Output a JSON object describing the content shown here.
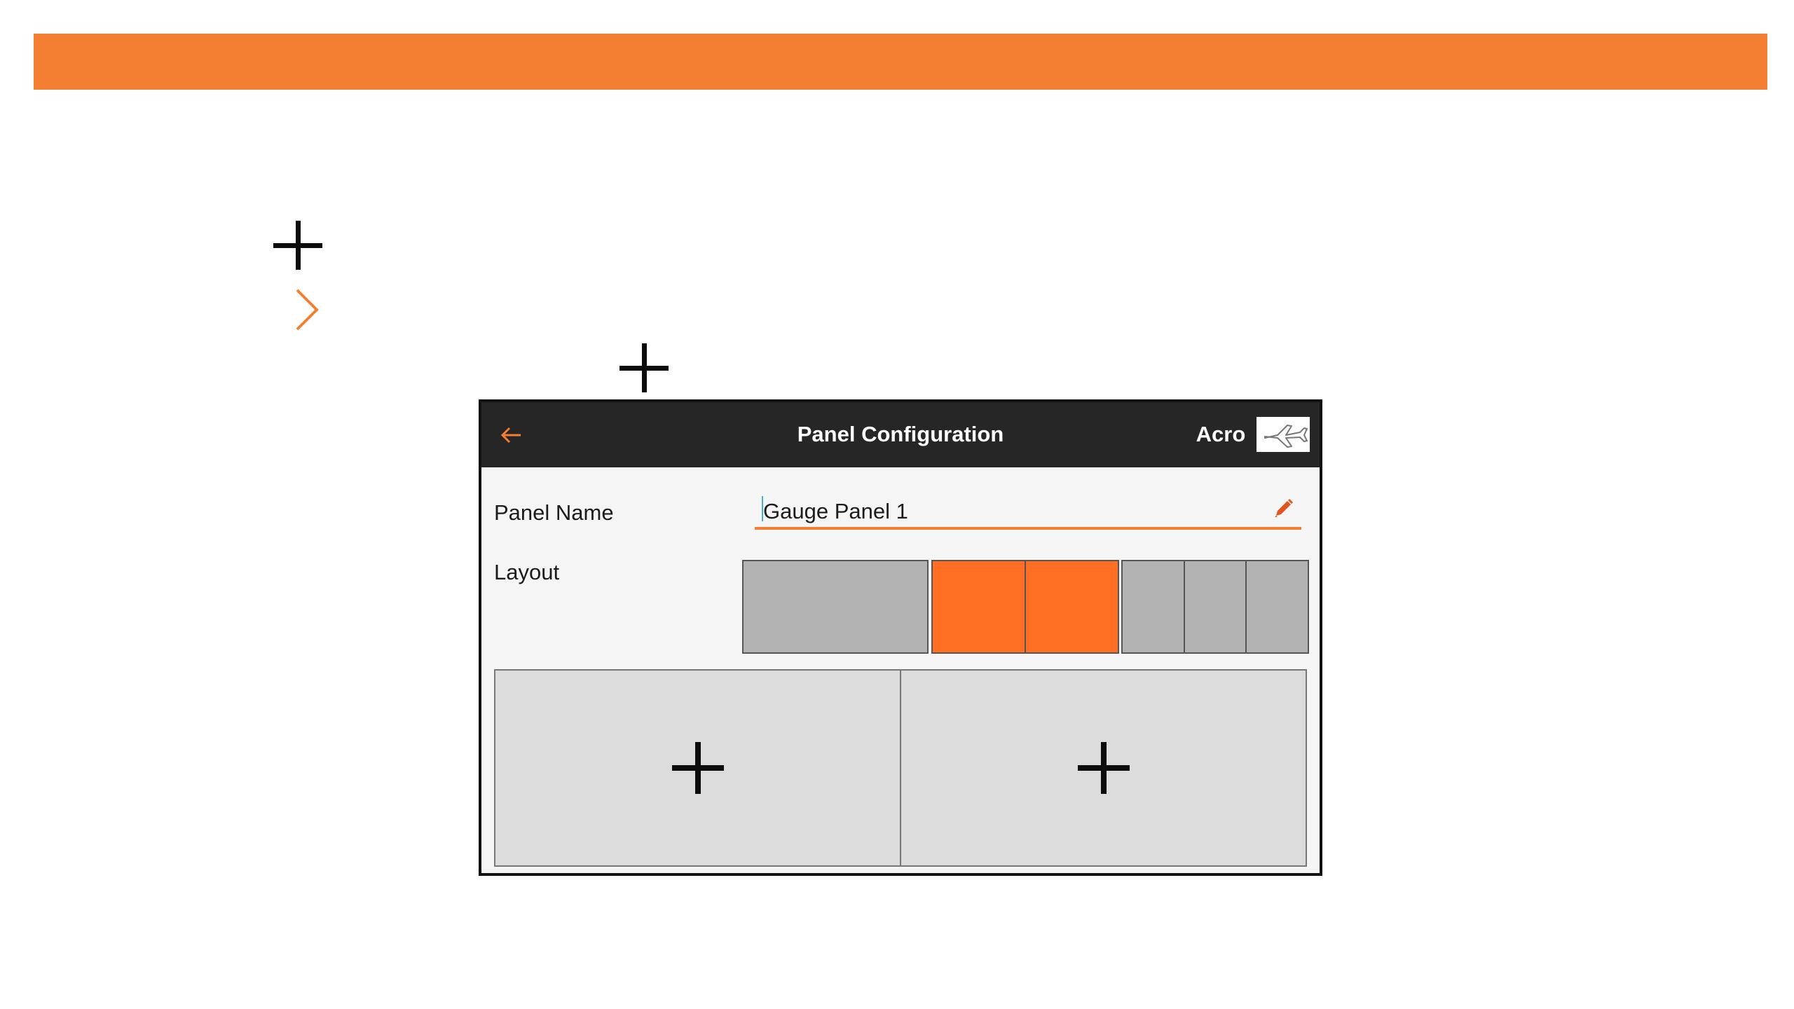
{
  "colors": {
    "accent": "#f47f32",
    "selected": "#ff6e23",
    "titlebar": "#262626"
  },
  "header": {
    "title": "Panel Configuration",
    "model": "Acro",
    "back_icon": "back-arrow-icon",
    "model_icon": "airplane-icon"
  },
  "panel_name": {
    "label": "Panel Name",
    "value": "Gauge Panel 1",
    "edit_icon": "pencil-icon"
  },
  "layout": {
    "label": "Layout",
    "options": [
      {
        "slots": 1,
        "selected": false
      },
      {
        "slots": 2,
        "selected": true
      },
      {
        "slots": 3,
        "selected": false
      }
    ]
  },
  "slots": [
    {
      "icon": "plus-icon"
    },
    {
      "icon": "plus-icon"
    }
  ]
}
